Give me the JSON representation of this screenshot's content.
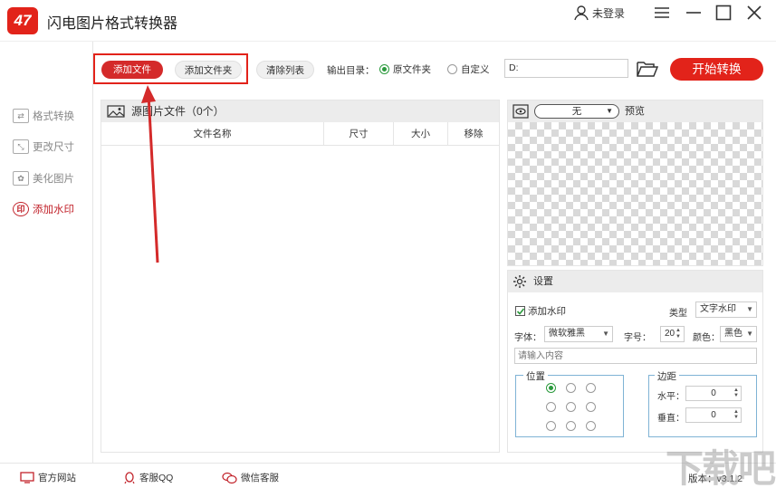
{
  "app": {
    "logo_text": "47",
    "title": "闪电图片格式转换器",
    "user_label": "未登录"
  },
  "sidebar": {
    "items": [
      {
        "label": "格式转换",
        "icon": "convert-icon"
      },
      {
        "label": "更改尺寸",
        "icon": "resize-icon"
      },
      {
        "label": "美化图片",
        "icon": "beautify-icon"
      },
      {
        "label": "添加水印",
        "icon": "watermark-icon",
        "icon_text": "印"
      }
    ],
    "active_index": 3
  },
  "toolbar": {
    "add_file": "添加文件",
    "add_folder": "添加文件夹",
    "clear_list": "清除列表",
    "output_label": "输出目录：",
    "output_original": "原文件夹",
    "output_custom": "自定义",
    "output_path": "D:",
    "start": "开始转换"
  },
  "files": {
    "title": "源图片文件（0个）",
    "columns": [
      "文件名称",
      "尺寸",
      "大小",
      "移除"
    ]
  },
  "preview": {
    "select_value": "无",
    "label": "预览"
  },
  "settings": {
    "title": "设置",
    "add_watermark": "添加水印",
    "add_watermark_checked": true,
    "type_label": "类型",
    "type_value": "文字水印",
    "font_label": "字体：",
    "font_value": "微软雅黑",
    "size_label": "字号：",
    "size_value": "20",
    "color_label": "颜色：",
    "color_value": "黑色",
    "content_placeholder": "请输入内容",
    "position_label": "位置",
    "position_selected": 0,
    "margin_label": "边距",
    "horizontal_label": "水平：",
    "horizontal_value": "0",
    "vertical_label": "垂直：",
    "vertical_value": "0"
  },
  "status": {
    "website": "官方网站",
    "qq": "客服QQ",
    "wechat": "微信客服",
    "version": "版本：v3.1.2"
  },
  "watermark_logo": "下载吧",
  "colors": {
    "brand_red": "#e2231a",
    "radio_green": "#2b9a3d",
    "fieldset_blue": "#7fb3d5"
  }
}
